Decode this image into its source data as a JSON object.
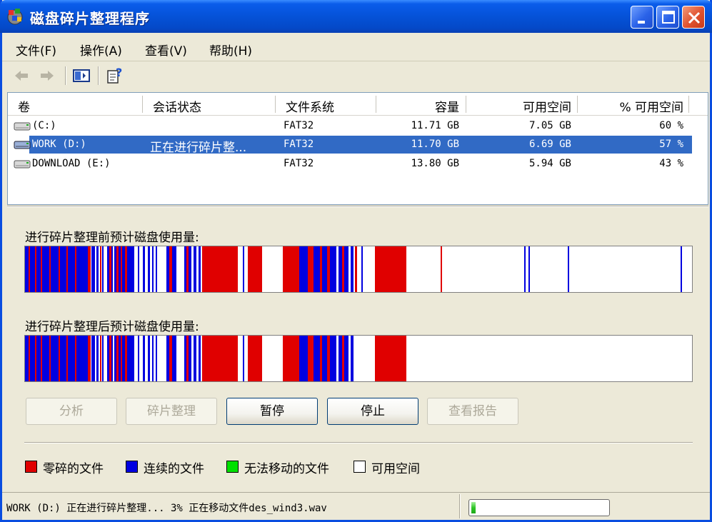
{
  "window": {
    "title": "磁盘碎片整理程序"
  },
  "menu": [
    "文件(F)",
    "操作(A)",
    "查看(V)",
    "帮助(H)"
  ],
  "toolbar": [
    "back-icon",
    "forward-icon",
    "view-panel-icon",
    "help-properties-icon"
  ],
  "volumes": {
    "columns": [
      "卷",
      "会话状态",
      "文件系统",
      "容量",
      "可用空间",
      "% 可用空间"
    ],
    "rows": [
      {
        "volume": "(C:)",
        "status": "",
        "fs": "FAT32",
        "capacity": "11.71 GB",
        "free": "7.05 GB",
        "pct": "60 %"
      },
      {
        "volume": "WORK (D:)",
        "status": "正在进行碎片整...",
        "fs": "FAT32",
        "capacity": "11.70 GB",
        "free": "6.69 GB",
        "pct": "57 %",
        "selected": true
      },
      {
        "volume": "DOWNLOAD (E:)",
        "status": "",
        "fs": "FAT32",
        "capacity": "13.80 GB",
        "free": "5.94 GB",
        "pct": "43 %"
      }
    ]
  },
  "before_label": "进行碎片整理前预计磁盘使用量:",
  "after_label": "进行碎片整理后预计磁盘使用量:",
  "buttons": {
    "analyze": "分析",
    "defragment": "碎片整理",
    "pause": "暂停",
    "stop": "停止",
    "view_report": "查看报告"
  },
  "legend": {
    "fragmented": "零碎的文件",
    "contiguous": "连续的文件",
    "unmovable": "无法移动的文件",
    "free": "可用空间"
  },
  "colors": {
    "fragmented": "#E00000",
    "contiguous": "#0000E0",
    "unmovable": "#00E000",
    "free": "#FFFFFF",
    "selection": "#316AC5",
    "titlebar": "#0552D8"
  },
  "status": {
    "text": "WORK (D:) 正在进行碎片整理... 3%  正在移动文件des_wind3.wav",
    "progress": 0.03
  }
}
